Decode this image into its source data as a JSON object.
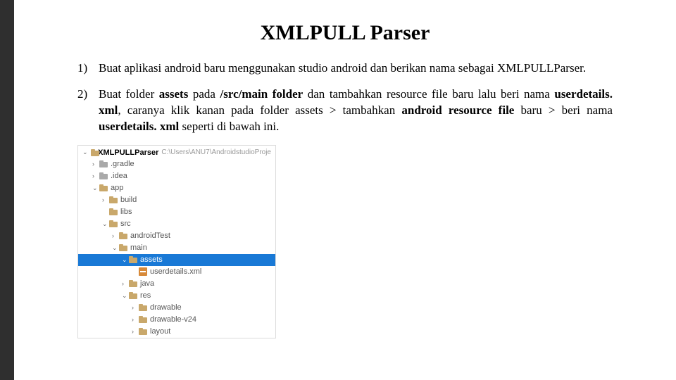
{
  "title": "XMLPULL Parser",
  "items": [
    {
      "num": "1)",
      "html": "Buat aplikasi android baru menggunakan studio android dan berikan nama sebagai XMLPULLParser."
    },
    {
      "num": "2)",
      "html": "Buat folder <b>assets</b> pada <b>/src/main folder</b> dan tambahkan resource file baru lalu beri nama <b>userdetails. xml</b>, caranya klik kanan pada folder assets > tambahkan <b>android resource file</b> baru > beri nama <b>userdetails. xml</b> seperti di bawah ini."
    }
  ],
  "tree": {
    "project_name": "XMLPULLParser",
    "project_path": "C:\\Users\\ANU7\\AndroidstudioProje",
    "rows": [
      {
        "indent": 1,
        "arrow": "›",
        "icon": "folder-grey",
        "label": ".gradle"
      },
      {
        "indent": 1,
        "arrow": "›",
        "icon": "folder-grey",
        "label": ".idea"
      },
      {
        "indent": 1,
        "arrow": "⌄",
        "icon": "folder",
        "label": "app"
      },
      {
        "indent": 2,
        "arrow": "›",
        "icon": "folder",
        "label": "build"
      },
      {
        "indent": 2,
        "arrow": "",
        "icon": "folder",
        "label": "libs"
      },
      {
        "indent": 2,
        "arrow": "⌄",
        "icon": "folder",
        "label": "src"
      },
      {
        "indent": 3,
        "arrow": "›",
        "icon": "folder",
        "label": "androidTest"
      },
      {
        "indent": 3,
        "arrow": "⌄",
        "icon": "folder",
        "label": "main"
      },
      {
        "indent": 4,
        "arrow": "⌄",
        "icon": "folder",
        "label": "assets",
        "selected": true
      },
      {
        "indent": 5,
        "arrow": "",
        "icon": "xml",
        "label": "userdetails.xml"
      },
      {
        "indent": 4,
        "arrow": "›",
        "icon": "folder",
        "label": "java"
      },
      {
        "indent": 4,
        "arrow": "⌄",
        "icon": "folder",
        "label": "res"
      },
      {
        "indent": 5,
        "arrow": "›",
        "icon": "folder",
        "label": "drawable"
      },
      {
        "indent": 5,
        "arrow": "›",
        "icon": "folder",
        "label": "drawable-v24"
      },
      {
        "indent": 5,
        "arrow": "›",
        "icon": "folder",
        "label": "layout"
      }
    ]
  }
}
